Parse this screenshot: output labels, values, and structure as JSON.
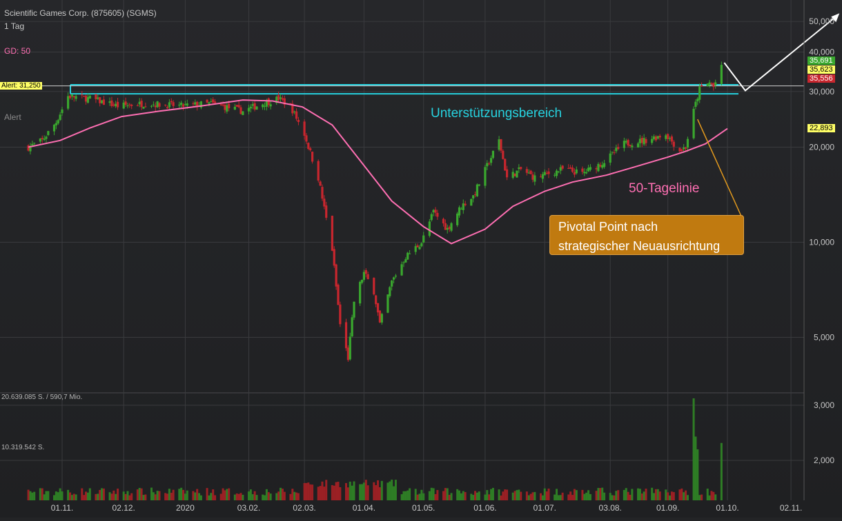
{
  "header": {
    "title": "Scientific Games Corp. (875605) (SGMS)",
    "interval": "1 Tag",
    "ma_label": "GD: 50",
    "alert_label": "Alert"
  },
  "annotations": {
    "support": "Unterstützungsbereich",
    "ma_line": "50-Tagelinie",
    "pivot_line1": "Pivotal Point nach",
    "pivot_line2": "strategischer Neuausrichtung",
    "alert_tag": "Alert: 31,250"
  },
  "price_tags": {
    "high": "35,691",
    "close": "35,623",
    "low": "35,556",
    "ma": "22,893"
  },
  "volume_labels": {
    "max": "20.639.085 S. / 590,7 Mio.",
    "mid": "10.319.542 S."
  },
  "colors": {
    "up": "#3aa82e",
    "down": "#c8262e",
    "ma": "#ff6fb3",
    "support": "#27d3e0",
    "pivot": "#e39a1e",
    "alert": "#ffff66"
  },
  "chart_data": {
    "type": "candlestick",
    "title": "Scientific Games Corp. (875605) (SGMS)",
    "y_scale": "log",
    "y_ticks": [
      "50,000",
      "40,000",
      "30,000",
      "20,000",
      "10,000",
      "5,000"
    ],
    "y_ticks_values": [
      50,
      40,
      30,
      20,
      10,
      5
    ],
    "vol_ticks": [
      "3,000",
      "2,000"
    ],
    "x_ticks": [
      "01.11.",
      "02.12.",
      "2020",
      "03.02.",
      "02.03.",
      "01.04.",
      "01.05.",
      "01.06.",
      "01.07.",
      "03.08.",
      "01.09.",
      "01.10.",
      "02.11."
    ],
    "x_ticks_dates": [
      "2019-11-01",
      "2019-12-02",
      "2020-01-02",
      "2020-02-03",
      "2020-03-02",
      "2020-04-01",
      "2020-05-01",
      "2020-06-01",
      "2020-07-01",
      "2020-08-03",
      "2020-09-01",
      "2020-10-01",
      "2020-11-02"
    ],
    "support_zone": [
      29.5,
      31.5
    ],
    "alert_level": 31.25,
    "close_path": [
      [
        "2019-10-15",
        20.0
      ],
      [
        "2019-10-22",
        21.0
      ],
      [
        "2019-10-29",
        24.0
      ],
      [
        "2019-11-04",
        29.0
      ],
      [
        "2019-11-15",
        28.5
      ],
      [
        "2019-11-29",
        27.0
      ],
      [
        "2019-12-13",
        27.5
      ],
      [
        "2019-12-31",
        27.0
      ],
      [
        "2020-01-15",
        27.5
      ],
      [
        "2020-01-31",
        26.0
      ],
      [
        "2020-02-10",
        27.5
      ],
      [
        "2020-02-18",
        28.5
      ],
      [
        "2020-02-24",
        27.0
      ],
      [
        "2020-03-02",
        22.0
      ],
      [
        "2020-03-09",
        16.0
      ],
      [
        "2020-03-16",
        9.5
      ],
      [
        "2020-03-20",
        5.5
      ],
      [
        "2020-03-24",
        4.3
      ],
      [
        "2020-03-27",
        6.5
      ],
      [
        "2020-04-01",
        8.0
      ],
      [
        "2020-04-06",
        7.0
      ],
      [
        "2020-04-09",
        5.5
      ],
      [
        "2020-04-15",
        7.5
      ],
      [
        "2020-04-22",
        9.0
      ],
      [
        "2020-04-30",
        10.0
      ],
      [
        "2020-05-06",
        12.5
      ],
      [
        "2020-05-13",
        11.0
      ],
      [
        "2020-05-20",
        13.0
      ],
      [
        "2020-05-26",
        14.0
      ],
      [
        "2020-06-03",
        18.0
      ],
      [
        "2020-06-08",
        21.0
      ],
      [
        "2020-06-12",
        16.0
      ],
      [
        "2020-06-19",
        17.0
      ],
      [
        "2020-06-26",
        16.0
      ],
      [
        "2020-07-03",
        16.5
      ],
      [
        "2020-07-10",
        17.0
      ],
      [
        "2020-07-20",
        16.5
      ],
      [
        "2020-07-31",
        18.0
      ],
      [
        "2020-08-10",
        20.5
      ],
      [
        "2020-08-20",
        21.0
      ],
      [
        "2020-08-31",
        22.0
      ],
      [
        "2020-09-07",
        19.5
      ],
      [
        "2020-09-10",
        20.0
      ],
      [
        "2020-09-14",
        26.0
      ],
      [
        "2020-09-17",
        30.5
      ],
      [
        "2020-09-22",
        32.0
      ],
      [
        "2020-09-24",
        31.0
      ],
      [
        "2020-09-28",
        35.6
      ]
    ],
    "ma50": [
      [
        "2019-10-15",
        20.0
      ],
      [
        "2019-10-31",
        21.0
      ],
      [
        "2019-11-15",
        23.0
      ],
      [
        "2019-12-01",
        25.0
      ],
      [
        "2019-12-20",
        26.0
      ],
      [
        "2020-01-10",
        27.0
      ],
      [
        "2020-01-31",
        28.2
      ],
      [
        "2020-02-15",
        28.0
      ],
      [
        "2020-03-01",
        26.8
      ],
      [
        "2020-03-16",
        23.5
      ],
      [
        "2020-04-01",
        17.5
      ],
      [
        "2020-04-15",
        13.5
      ],
      [
        "2020-05-01",
        11.2
      ],
      [
        "2020-05-15",
        9.9
      ],
      [
        "2020-06-01",
        11.0
      ],
      [
        "2020-06-15",
        13.0
      ],
      [
        "2020-07-01",
        14.5
      ],
      [
        "2020-07-15",
        15.5
      ],
      [
        "2020-08-01",
        16.3
      ],
      [
        "2020-08-15",
        17.3
      ],
      [
        "2020-09-01",
        18.6
      ],
      [
        "2020-09-10",
        19.4
      ],
      [
        "2020-09-20",
        20.5
      ],
      [
        "2020-10-01",
        22.893
      ]
    ],
    "volume_spikes": [
      [
        "2020-09-14",
        3.2
      ],
      [
        "2020-09-15",
        2.0
      ],
      [
        "2020-09-16",
        1.6
      ],
      [
        "2020-09-28",
        1.8
      ]
    ]
  }
}
